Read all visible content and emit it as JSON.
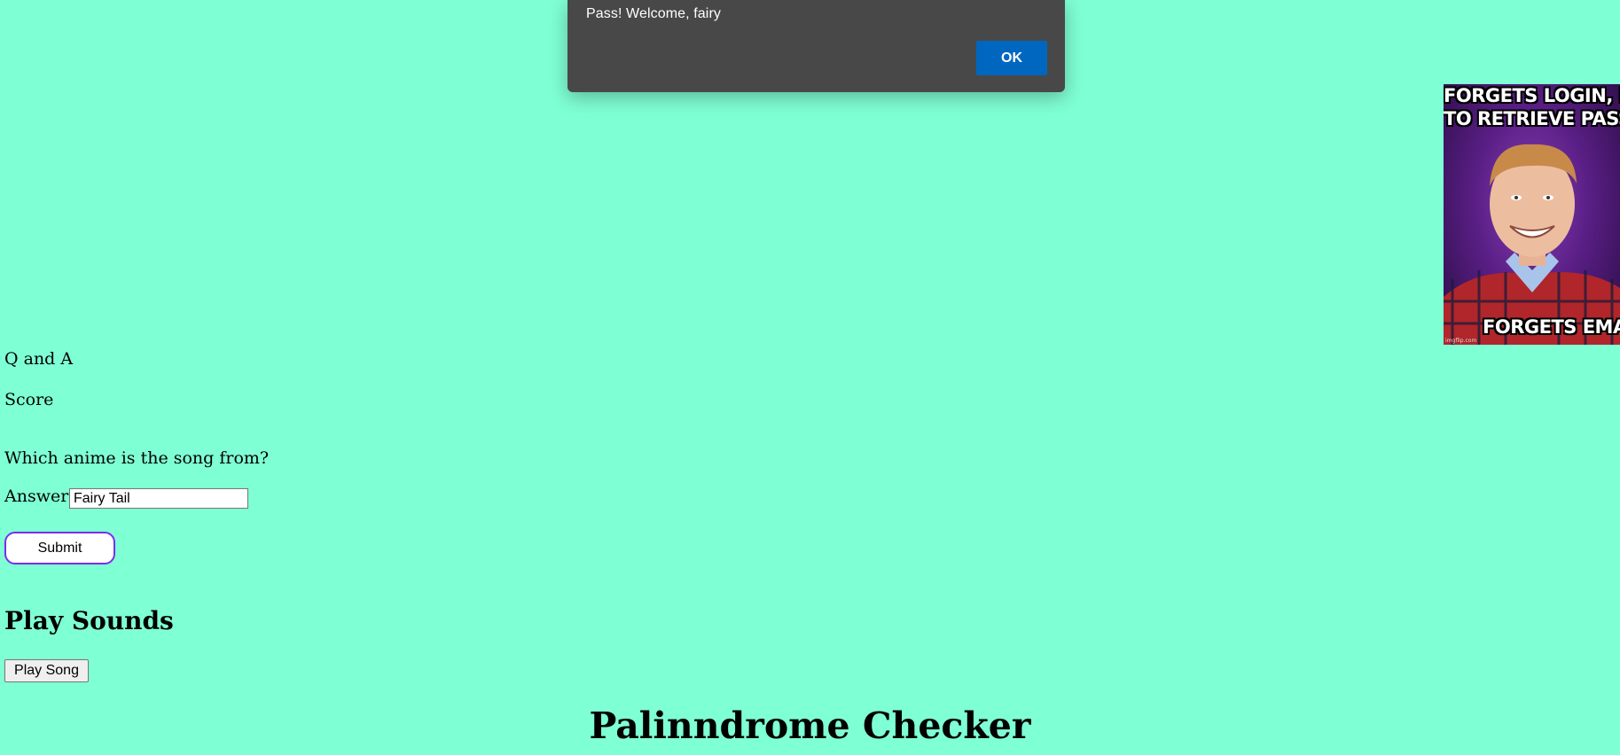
{
  "alert": {
    "message": "Pass! Welcome, fairy",
    "ok_label": "OK",
    "ok_color": "#0067c0"
  },
  "meme": {
    "top_text": "FORGETS LOGIN, HAS\nTO RETRIEVE PASSWORD",
    "top_line1": "FORGETS LOGIN, HAS",
    "top_line2": "TO RETRIEVE PASSWORD",
    "bottom_text": "FORGETS EMAIL",
    "watermark": "imgflip.com"
  },
  "qa": {
    "heading": "Q and A",
    "score_label": "Score",
    "question": "Which anime is the song from?",
    "answer_label": "Answer:",
    "answer_value": "Fairy Tail",
    "submit_label": "Submit"
  },
  "sounds": {
    "heading": "Play Sounds",
    "play_label": "Play Song"
  },
  "palindrome": {
    "heading": "Palinndrome Checker"
  },
  "colors": {
    "page_background": "#7fffd4",
    "submit_border": "#7b2cf0"
  }
}
